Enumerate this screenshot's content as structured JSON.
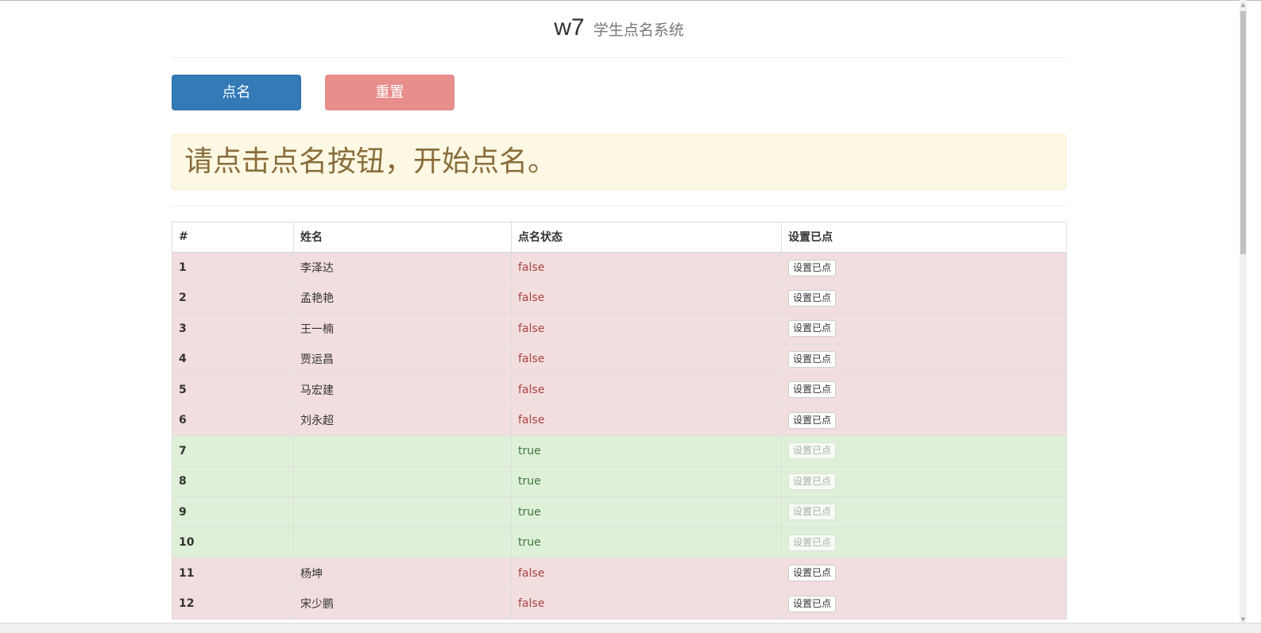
{
  "header": {
    "brand": "w7",
    "subtitle": "学生点名系统"
  },
  "buttons": {
    "call_label": "点名",
    "reset_label": "重置"
  },
  "alert": {
    "message": "请点击点名按钮，开始点名。"
  },
  "table": {
    "columns": [
      "#",
      "姓名",
      "点名状态",
      "设置已点"
    ],
    "rows": [
      {
        "idx": "1",
        "name": "李泽达",
        "status": "false",
        "action": "设置已点"
      },
      {
        "idx": "2",
        "name": "孟艳艳",
        "status": "false",
        "action": "设置已点"
      },
      {
        "idx": "3",
        "name": "王一楠",
        "status": "false",
        "action": "设置已点"
      },
      {
        "idx": "4",
        "name": "贾运昌",
        "status": "false",
        "action": "设置已点"
      },
      {
        "idx": "5",
        "name": "马宏建",
        "status": "false",
        "action": "设置已点"
      },
      {
        "idx": "6",
        "name": "刘永超",
        "status": "false",
        "action": "设置已点"
      },
      {
        "idx": "7",
        "name": "",
        "status": "true",
        "action": "设置已点"
      },
      {
        "idx": "8",
        "name": "",
        "status": "true",
        "action": "设置已点"
      },
      {
        "idx": "9",
        "name": "",
        "status": "true",
        "action": "设置已点"
      },
      {
        "idx": "10",
        "name": "",
        "status": "true",
        "action": "设置已点"
      },
      {
        "idx": "11",
        "name": "杨坤",
        "status": "false",
        "action": "设置已点"
      },
      {
        "idx": "12",
        "name": "宋少鹏",
        "status": "false",
        "action": "设置已点"
      }
    ]
  },
  "colors": {
    "primary": "#337ab7",
    "danger_light": "#e88e8c",
    "warning_bg": "#fcf8e3",
    "warning_text": "#8a6d3b",
    "row_false_bg": "#f2dede",
    "row_true_bg": "#dff0d8"
  }
}
